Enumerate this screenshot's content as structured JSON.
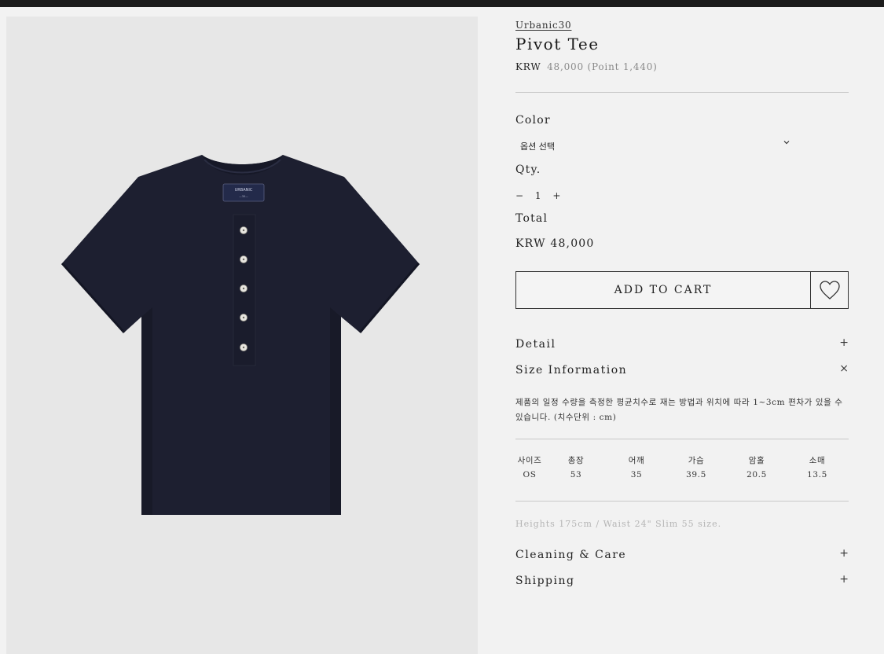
{
  "product": {
    "brand": "Urbanic30",
    "title": "Pivot Tee",
    "price_currency": "KRW",
    "price_amount": "48,000",
    "price_point": "(Point 1,440)",
    "image_alt": "Navy short-sleeve henley tee",
    "image_color": "#1d1f30"
  },
  "options": {
    "color_label": "Color",
    "color_select_value": "옵션 선택",
    "qty_label": "Qty.",
    "qty_minus": "−",
    "qty_value": "1",
    "qty_plus": "+",
    "total_label": "Total",
    "total_value": "KRW 48,000"
  },
  "actions": {
    "add_to_cart": "ADD TO CART",
    "wishlist_icon": "heart-icon"
  },
  "accordion": {
    "detail_label": "Detail",
    "detail_sign": "+",
    "size_label": "Size Information",
    "size_sign": "×",
    "size_note": "제품의 일정 수량을 측정한 평균치수로 재는 방법과 위치에 따라 1~3cm 편차가 있을 수 있습니다. (치수단위 : cm)",
    "size_headers": [
      "사이즈",
      "총장",
      "어깨",
      "가슴",
      "암홀",
      "소매"
    ],
    "size_values": [
      "OS",
      "53",
      "35",
      "39.5",
      "20.5",
      "13.5"
    ],
    "fit_note": "Heights 175cm / Waist 24\" Slim 55 size.",
    "care_label": "Cleaning & Care",
    "care_sign": "+",
    "shipping_label": "Shipping",
    "shipping_sign": "+"
  },
  "colors": {
    "accent": "#222222",
    "background": "#f2f2f2",
    "image_bg": "#e7e7e7"
  }
}
